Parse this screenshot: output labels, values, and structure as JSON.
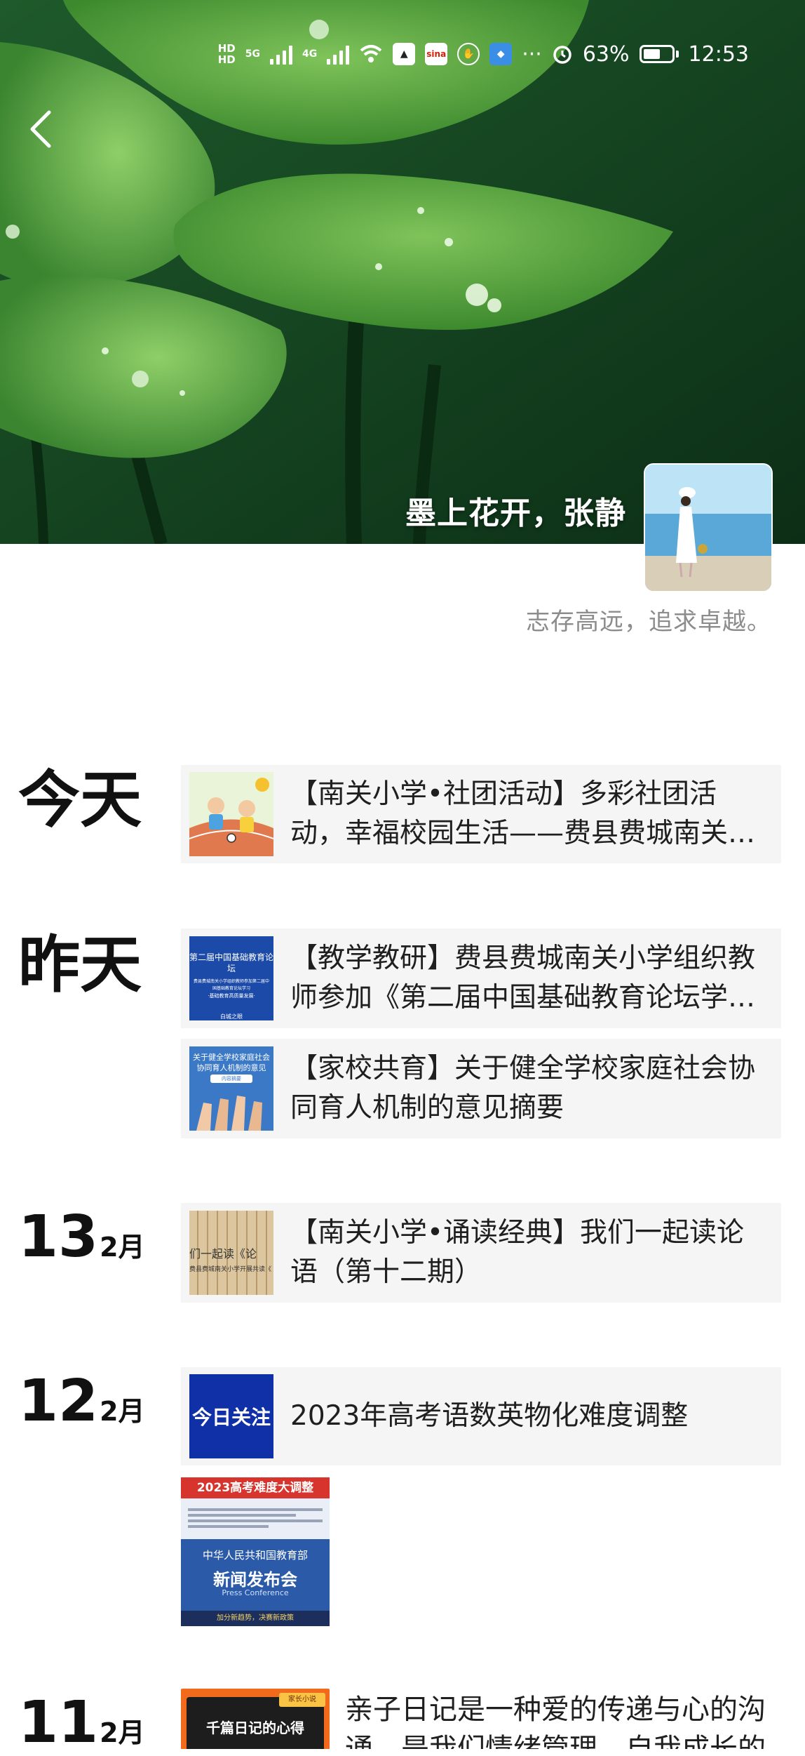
{
  "status_bar": {
    "network_1": "HD",
    "network_2": "HD",
    "signal_1_gen": "5G",
    "signal_2_gen": "4G",
    "battery_percent": "63%",
    "battery_level": 0.63,
    "time": "12:53",
    "more": "···",
    "icons": [
      "wifi-icon",
      "alert-app-icon",
      "sina-app-icon",
      "hand-app-icon",
      "shield-app-icon",
      "alarm-icon"
    ]
  },
  "profile": {
    "name": "墨上花开，张静",
    "signature": "志存高远，追求卓越。"
  },
  "feed": [
    {
      "date_word": "今天",
      "posts": [
        {
          "title": "【南关小学•社团活动】多彩社团活动，幸福校园生活——费县费城南关小学社团活动"
        }
      ]
    },
    {
      "date_word": "昨天",
      "posts": [
        {
          "title": "【教学教研】费县费城南关小学组织教师参加《第二届中国基础教育论坛学习》",
          "thumb_text_1": "第二届中国基础教育论坛",
          "thumb_text_2": "费县费城南关小学组织教师参加第二届中国基础教育论坛学习",
          "thumb_text_3": "·基础教育高质量发展·",
          "thumb_text_4": "白城之眼"
        },
        {
          "title": "【家校共育】关于健全学校家庭社会协同育人机制的意见摘要",
          "thumb_text_1": "关于健全学校家庭社会",
          "thumb_text_2": "协同育人机制的意见",
          "thumb_text_3": "内容摘要"
        }
      ]
    },
    {
      "day": "13",
      "month": "2月",
      "posts": [
        {
          "title": "【南关小学•诵读经典】我们一起读论语（第十二期）",
          "thumb_text_1": "们一起读《论",
          "thumb_text_2": "费县费城南关小学开展共读《"
        }
      ]
    },
    {
      "day": "12",
      "month": "2月",
      "posts": [
        {
          "title": "2023年高考语数英物化难度调整",
          "thumb_text": "今日关注"
        }
      ],
      "image": {
        "banner": "2023高考难度大调整",
        "org": "中华人民共和国教育部",
        "event": "新闻发布会",
        "event_en": "Press Conference",
        "bottom": "加分新趋势，决赛新政策"
      }
    },
    {
      "day": "11",
      "month": "2月",
      "diary": {
        "title": "亲子日记是一种爱的传递与心的沟通，是我们情绪管理、自我成长的",
        "thumb_title": "千篇日记的心得",
        "thumb_badge": "家长小说"
      }
    }
  ]
}
